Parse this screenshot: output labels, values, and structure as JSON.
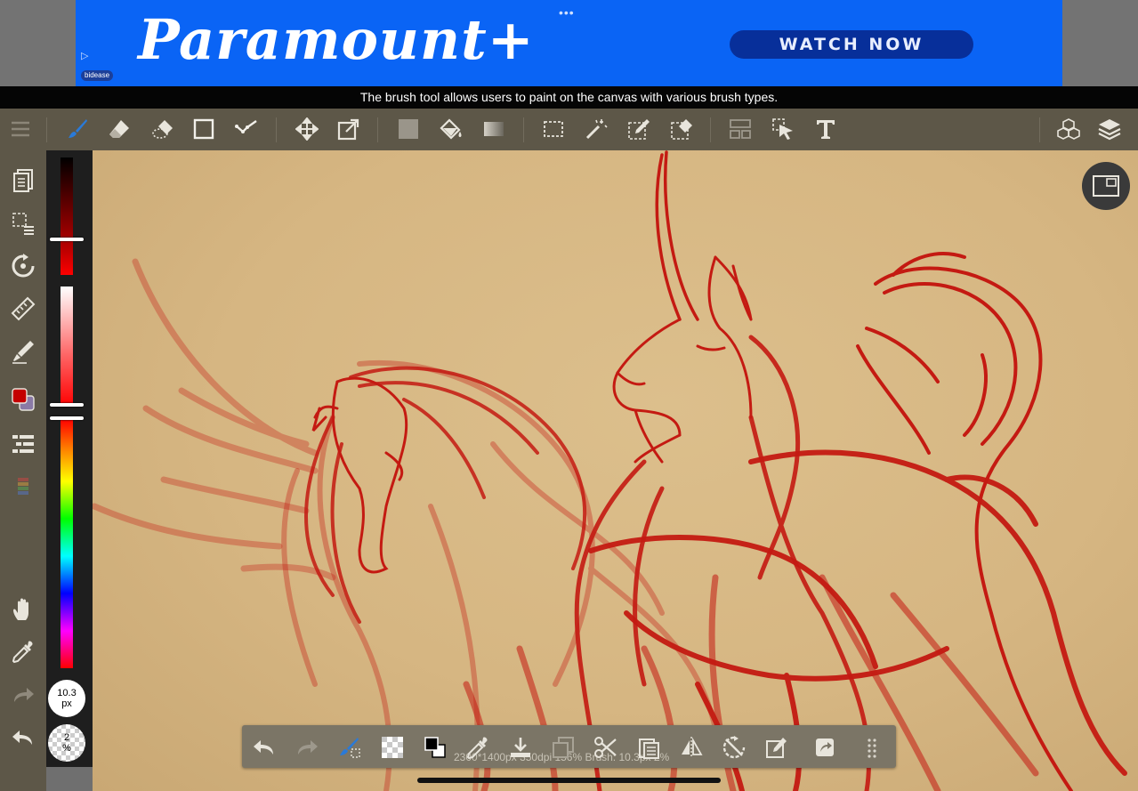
{
  "ad": {
    "brand": "Paramount+",
    "cta": "WATCH NOW",
    "dots": "•••",
    "badge": "bidease"
  },
  "tooltip": "The brush tool allows users to paint on the canvas with various brush types.",
  "toolbar": {
    "active_tool": "brush",
    "tools": [
      "menu",
      "brush",
      "eraser",
      "smudge",
      "shape",
      "correction",
      "move",
      "transform",
      "fill-color",
      "bucket",
      "gradient",
      "select",
      "magic-wand",
      "select-pen",
      "select-eraser",
      "frame-divider",
      "operation",
      "text",
      "3d",
      "layers"
    ]
  },
  "colors": {
    "primary": "#c40000",
    "secondary": "#8a7aa6",
    "accent": "#2a7ad8",
    "line": "#b80a0a"
  },
  "brush": {
    "size_value": "10.3",
    "size_unit": "px",
    "opacity_value": "2",
    "opacity_unit": "%"
  },
  "status": "2300*1400px 350dpi 156% Brush: 10.3px 2%"
}
